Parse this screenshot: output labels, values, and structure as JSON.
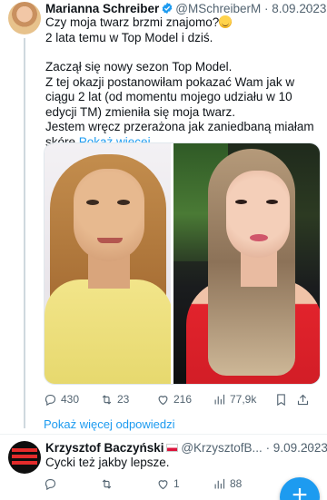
{
  "tweet": {
    "author_name": "Marianna Schreiber",
    "handle": "@MSchreiberM",
    "date": "· 8.09.2023",
    "line1": "Czy moja twarz brzmi znajomo?",
    "line2": "2 lata temu w Top Model i dziś.",
    "line3": "Zaczął się nowy sezon Top Model.",
    "line4": "Z tej okazji postanowiłam pokazać Wam jak w ciągu 2 lat (od momentu mojego udziału w 10 edycji TM) zmieniła się moja twarz.",
    "line5": "Jestem wręcz przerażona jak zaniedbaną miałam skórę",
    "show_more": "Pokaż więcej",
    "stats": {
      "replies": "430",
      "retweets": "23",
      "likes": "216",
      "views": "77,9k"
    }
  },
  "show_more_replies": "Pokaż więcej odpowiedzi",
  "reply": {
    "author_name": "Krzysztof Baczyński",
    "handle": "@KrzysztofB...",
    "date": "· 9.09.2023",
    "text": "Cycki też jakby lepsze.",
    "stats": {
      "likes": "1",
      "views": "88"
    }
  },
  "icons": [
    "more-icon",
    "verified-badge-icon",
    "reply-icon",
    "retweet-icon",
    "like-icon",
    "views-icon",
    "bookmark-icon",
    "share-icon",
    "compose-plus-icon"
  ],
  "colors": {
    "accent": "#1d9bf0",
    "text": "#0f1419",
    "muted": "#536471"
  }
}
